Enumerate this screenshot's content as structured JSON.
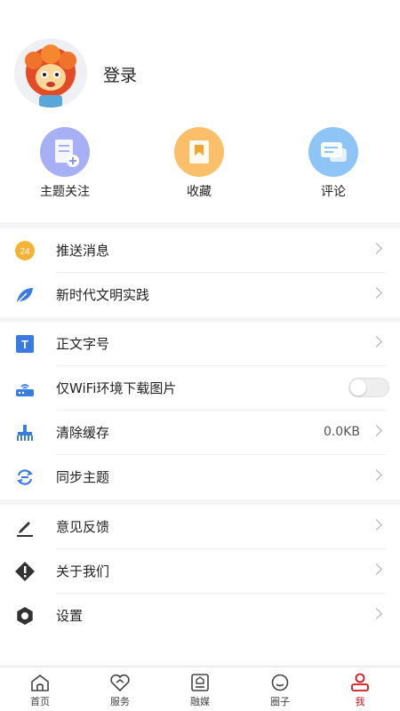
{
  "profile": {
    "login_label": "登录"
  },
  "quick_actions": [
    {
      "label": "主题关注",
      "icon": "topic-add-icon",
      "color": "#a7b0f4"
    },
    {
      "label": "收藏",
      "icon": "bookmark-icon",
      "color": "#fbbf6a"
    },
    {
      "label": "评论",
      "icon": "comment-icon",
      "color": "#8fc4f6"
    }
  ],
  "menu": {
    "group1": [
      {
        "label": "推送消息",
        "icon": "push-badge-icon"
      },
      {
        "label": "新时代文明实践",
        "icon": "leaf-icon"
      }
    ],
    "group2": [
      {
        "label": "正文字号",
        "icon": "text-size-icon"
      },
      {
        "label": "仅WiFi环境下载图片",
        "icon": "router-icon",
        "toggle": false
      },
      {
        "label": "清除缓存",
        "icon": "broom-icon",
        "value": "0.0KB"
      },
      {
        "label": "同步主题",
        "icon": "sync-icon"
      }
    ],
    "group3": [
      {
        "label": "意见反馈",
        "icon": "edit-icon"
      },
      {
        "label": "关于我们",
        "icon": "info-icon"
      },
      {
        "label": "设置",
        "icon": "gear-icon"
      }
    ]
  },
  "tabbar": [
    {
      "label": "首页",
      "icon": "home-icon"
    },
    {
      "label": "服务",
      "icon": "heart-service-icon"
    },
    {
      "label": "融媒",
      "icon": "media-icon"
    },
    {
      "label": "圈子",
      "icon": "circle-chat-icon"
    },
    {
      "label": "我",
      "icon": "user-icon",
      "active": true
    }
  ],
  "colors": {
    "accent": "#d0161b",
    "blue_icon": "#3a7be0",
    "dark_icon": "#333333",
    "badge": "#f5b335"
  }
}
